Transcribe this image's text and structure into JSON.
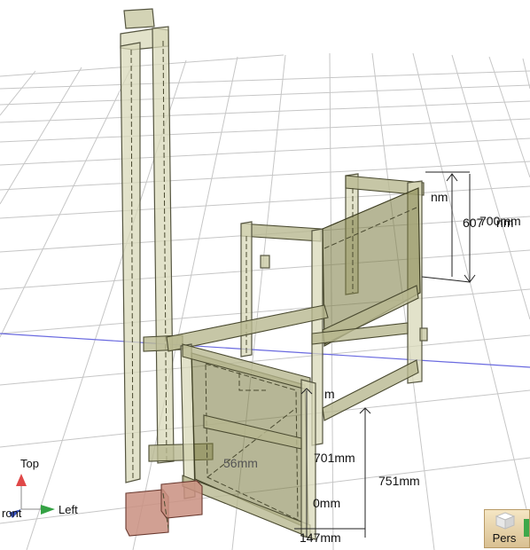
{
  "dimensions": {
    "d1": "701mm",
    "d2": "751mm",
    "d3": "147mm",
    "d4": "56mm",
    "d5": "0mm",
    "d6": "m",
    "d7": "nm",
    "d8": "607",
    "d9": "700mm",
    "d10": "nm"
  },
  "axis_gizmo": {
    "top_label": "Top",
    "left_label": "Left",
    "front_label": "ront",
    "colors": {
      "top": "#e04848",
      "left": "#34a244",
      "front": "#3a54c8"
    }
  },
  "view_cube": {
    "label": "Pers"
  },
  "colors": {
    "wood": "#d8d8b8",
    "panel": "#7a7a40",
    "block": "#c98f80",
    "grid": "#c6c6c6",
    "axis_line": "#6a6ae0"
  }
}
